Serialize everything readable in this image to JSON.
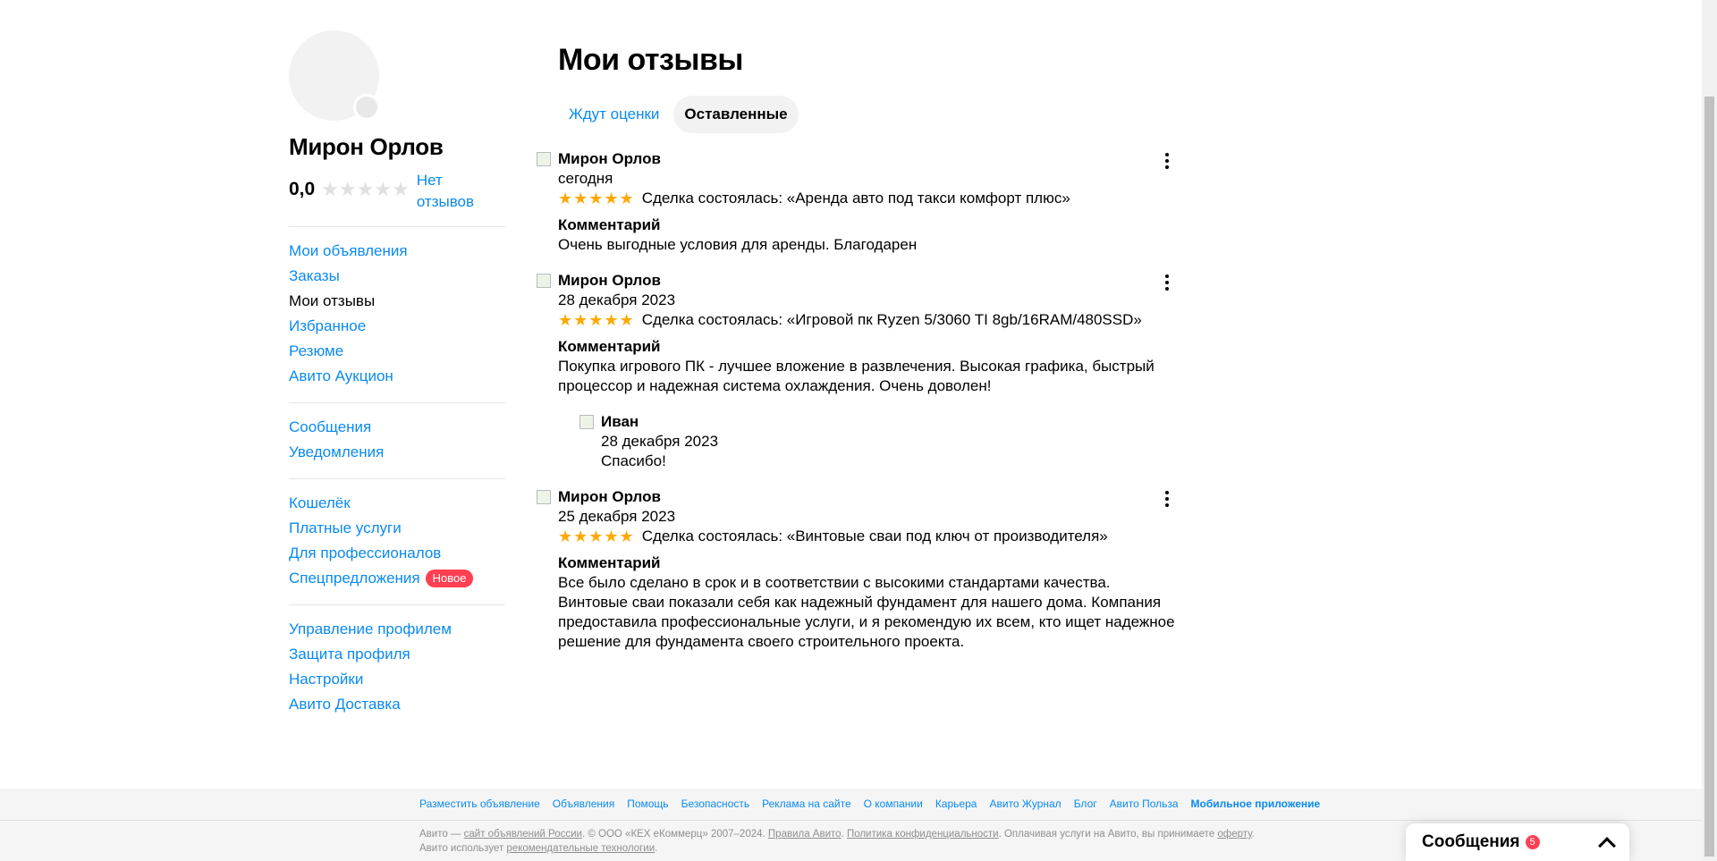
{
  "profile": {
    "name": "Мирон Орлов",
    "rating": "0,0",
    "stars": "★★★★★",
    "no_reviews": "Нет отзывов"
  },
  "sidebar": {
    "group1": [
      {
        "label": "Мои объявления",
        "current": false
      },
      {
        "label": "Заказы",
        "current": false
      },
      {
        "label": "Мои отзывы",
        "current": true
      },
      {
        "label": "Избранное",
        "current": false
      },
      {
        "label": "Резюме",
        "current": false
      },
      {
        "label": "Авито Аукцион",
        "current": false
      }
    ],
    "group2": [
      {
        "label": "Сообщения"
      },
      {
        "label": "Уведомления"
      }
    ],
    "group3": [
      {
        "label": "Кошелёк"
      },
      {
        "label": "Платные услуги"
      },
      {
        "label": "Для профессионалов"
      },
      {
        "label": "Спецпредложения",
        "badge": "Новое"
      }
    ],
    "group4": [
      {
        "label": "Управление профилем"
      },
      {
        "label": "Защита профиля"
      },
      {
        "label": "Настройки"
      },
      {
        "label": "Авито Доставка"
      }
    ]
  },
  "main": {
    "title": "Мои отзывы",
    "tabs": [
      {
        "label": "Ждут оценки",
        "active": false
      },
      {
        "label": "Оставленные",
        "active": true
      }
    ],
    "comment_label": "Комментарий",
    "stars": "★★★★★",
    "reviews": [
      {
        "author": "Мирон Орлов",
        "date": "сегодня",
        "rating": 5,
        "deal": "Сделка состоялась: «Аренда авто под такси комфорт плюс»",
        "comment": "Очень выгодные условия для аренды. Благодарен"
      },
      {
        "author": "Мирон Орлов",
        "date": "28 декабря 2023",
        "rating": 5,
        "deal": "Сделка состоялась: «Игровой пк Ryzen 5/3060 TI 8gb/16RAM/480SSD»",
        "comment": "Покупка игрового ПК - лучшее вложение в развлечения. Высокая графика, быстрый процессор и надежная система охлаждения. Очень доволен!",
        "reply": {
          "author": "Иван",
          "date": "28 декабря 2023",
          "text": "Спасибо!"
        }
      },
      {
        "author": "Мирон Орлов",
        "date": "25 декабря 2023",
        "rating": 5,
        "deal": "Сделка состоялась: «Винтовые сваи под ключ от производителя»",
        "comment": "Все было сделано в срок и в соответствии с высокими стандартами качества. Винтовые сваи показали себя как надежный фундамент для нашего дома. Компания предоставила профессиональные услуги, и я рекомендую их всем, кто ищет надежное решение для фундамента своего строительного проекта."
      }
    ]
  },
  "footer": {
    "links": [
      "Разместить объявление",
      "Объявления",
      "Помощь",
      "Безопасность",
      "Реклама на сайте",
      "О компании",
      "Карьера",
      "Авито Журнал",
      "Блог",
      "Авито Польза",
      "Мобильное приложение"
    ],
    "legal_1": "Авито — ",
    "legal_link_1": "сайт объявлений России",
    "legal_2": ". © ООО «КЕХ еКоммерц» 2007–2024. ",
    "legal_link_2": "Правила Авито",
    "legal_3": ". ",
    "legal_link_3": "Политика конфиденциальности",
    "legal_4": ". Оплачивая услуги на Авито, вы принимаете ",
    "legal_link_4": "оферту",
    "legal_5": ". Авито использует ",
    "legal_link_5": "рекомендательные технологии",
    "legal_6": "."
  },
  "messenger": {
    "title": "Сообщения",
    "count": "5"
  },
  "colors": {
    "link": "#0a8af0",
    "star": "#ffa800",
    "badge": "#ff4053"
  }
}
